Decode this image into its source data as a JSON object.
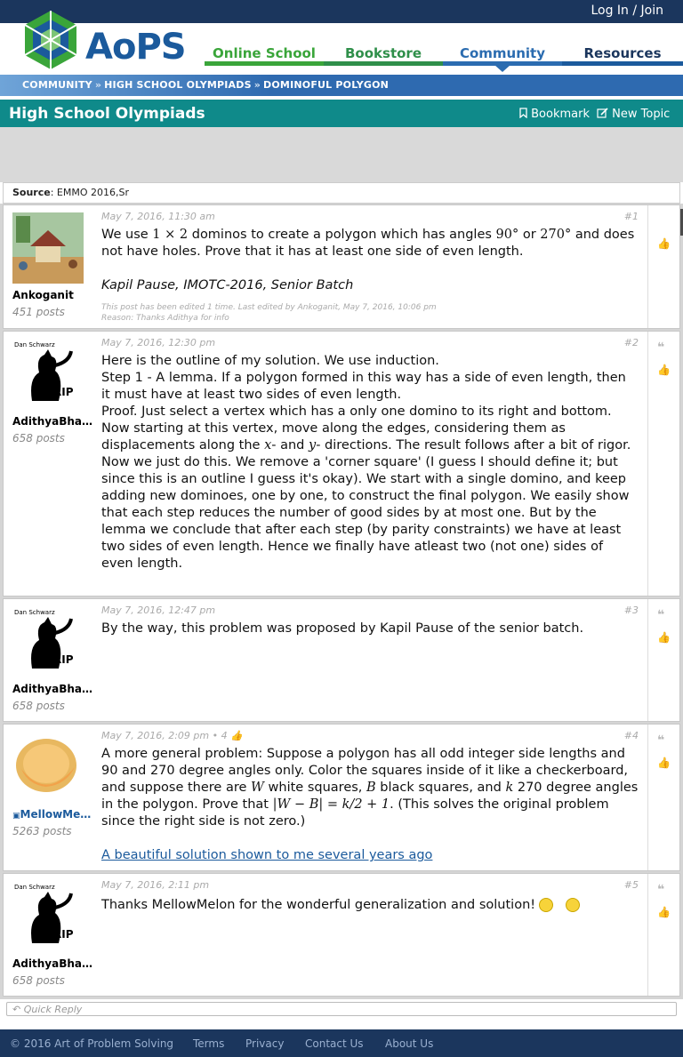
{
  "header": {
    "login_label": "Log In / Join",
    "logo_text": "AoPS",
    "nav": {
      "online_school": "Online School",
      "bookstore": "Bookstore",
      "community": "Community",
      "resources": "Resources"
    }
  },
  "breadcrumb": {
    "item1": "COMMUNITY",
    "item2": "HIGH SCHOOL OLYMPIADS",
    "item3": "DOMINOFUL POLYGON",
    "sep": "»"
  },
  "forum": {
    "title": "High School Olympiads",
    "bookmark_label": "Bookmark",
    "new_topic_label": "New Topic"
  },
  "source": {
    "label": "Source",
    "value": ": EMMO 2016,Sr"
  },
  "posts": [
    {
      "number": "#1",
      "date": "May 7, 2016, 11:30 am",
      "user": "Ankoganit",
      "posts": "451 posts",
      "text_a": "We use ",
      "math_a": "1 × 2",
      "text_b": " dominos to create a polygon which has angles ",
      "math_b": "90°",
      "text_c": " or ",
      "math_c": "270°",
      "text_d": " and does not have holes. Prove that it has at least one side of even length.",
      "credit": "Kapil Pause, IMOTC-2016, Senior Batch",
      "edited_line1": "This post has been edited 1 time. Last edited by Ankoganit, May 7, 2016, 10:06 pm",
      "edited_line2": "Reason: Thanks Adithya for info"
    },
    {
      "number": "#2",
      "date": "May 7, 2016, 12:30 pm",
      "user": "AdithyaBhas...",
      "posts": "658 posts",
      "p1": "Here is the outline of my solution. We use induction.",
      "p2": "Step 1 - A lemma. If a polygon formed in this way has a side of even length, then it must have at least two sides of even length.",
      "p3a": "Proof. Just select a vertex which has a only one domino to its right and bottom. Now starting at this vertex, move along the edges, considering them as displacements along the ",
      "p3x": "x",
      "p3b": "- and ",
      "p3y": "y",
      "p3c": "- directions. The result follows after a bit of rigor.",
      "p4": "Now we just do this. We remove a 'corner square' (I guess I should define it; but since this is an outline I guess it's okay). We start with a single domino, and keep adding new dominoes, one by one, to construct the final polygon. We easily show that each step reduces the number of good sides by at most one. But by the lemma we conclude that after each step (by parity constraints) we have at least two sides of even length. Hence we finally have atleast two (not one) sides of even length."
    },
    {
      "number": "#3",
      "date": "May 7, 2016, 12:47 pm",
      "user": "AdithyaBhas...",
      "posts": "658 posts",
      "text": "By the way, this problem was proposed by Kapil Pause of the senior batch."
    },
    {
      "number": "#4",
      "date": "May 7, 2016, 2:09 pm",
      "likes": "• 4",
      "user": "MellowMelon",
      "posts": "5263 posts",
      "t1": "A more general problem: Suppose a polygon has all odd integer side lengths and 90 and 270 degree angles only. Color the squares inside of it like a checkerboard, and suppose there are ",
      "mW": "W",
      "t2": " white squares, ",
      "mB": "B",
      "t3": " black squares, and ",
      "mk": "k",
      "t4": " 270 degree angles in the polygon. Prove that ",
      "mEq": "|W − B| = k/2 + 1",
      "t5": ". (This solves the original problem since the right side is not zero.)",
      "link": "A beautiful solution shown to me several years ago"
    },
    {
      "number": "#5",
      "date": "May 7, 2016, 2:11 pm",
      "user": "AdithyaBhas...",
      "posts": "658 posts",
      "text": "Thanks MellowMelon for the wonderful generalization and solution!"
    }
  ],
  "quick_reply": "Quick Reply",
  "footer": {
    "copyright": "© 2016 Art of Problem Solving",
    "terms": "Terms",
    "privacy": "Privacy",
    "contact": "Contact Us",
    "about": "About Us"
  },
  "colors": {
    "topbar": "#1b365d",
    "section": "#0f8a8a",
    "school": "#3aa53a",
    "community": "#2b6cb0"
  }
}
